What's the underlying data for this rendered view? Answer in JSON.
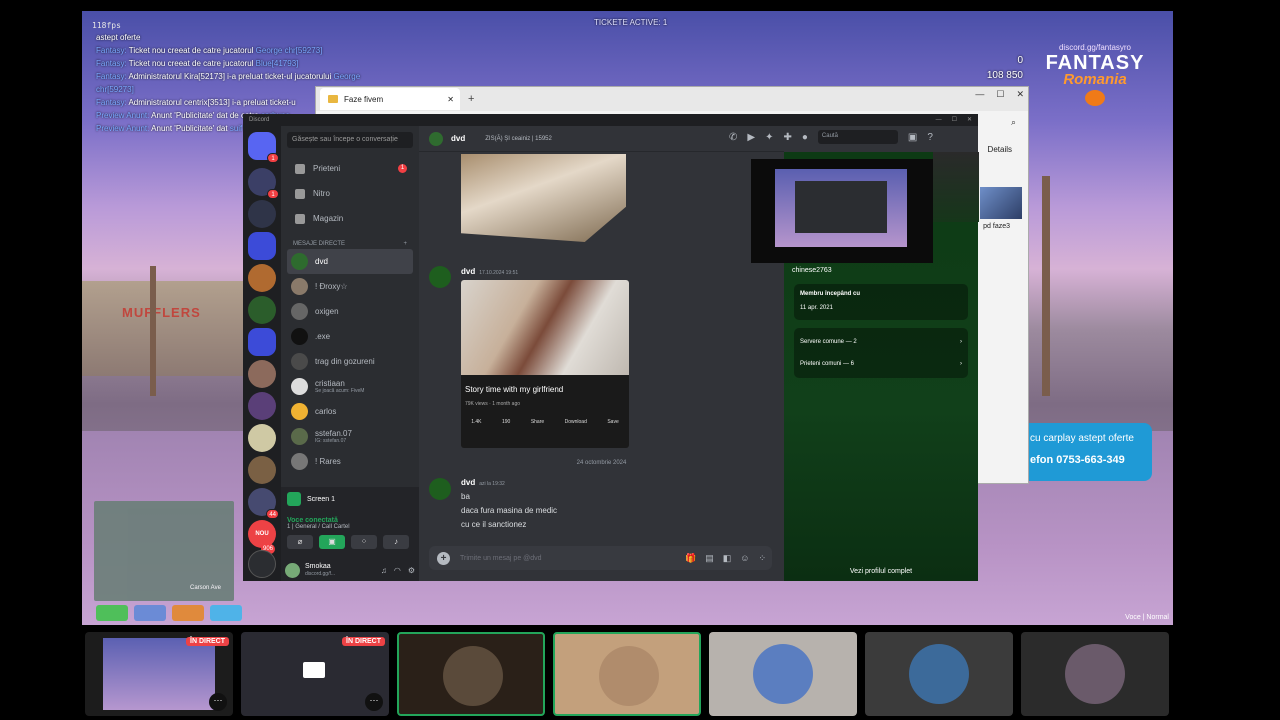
{
  "game": {
    "fps": "118fps",
    "ticket_title": "TICKETE ACTIVE: 1",
    "money_line1": "0",
    "money_line2": "108 850",
    "brand_url": "discord.gg/fantasyro",
    "brand_name": "FANTASY",
    "brand_sub": "Romania",
    "promo_line1": "cu carplay astept oferte",
    "promo_line2": "efon 0753-663-349",
    "voice_hud": "Voce | Normal",
    "street": "Carson Ave",
    "building_sign": "MUFFLERS",
    "chat": [
      {
        "prefix": "",
        "text": "astept oferte",
        "extra": ""
      },
      {
        "prefix": "Fantasy:",
        "text": "Ticket nou creeat de catre jucatorul",
        "extra": "George chr[59273]"
      },
      {
        "prefix": "Fantasy:",
        "text": "Ticket nou creeat de catre jucatorul",
        "extra": "Blue[41793]"
      },
      {
        "prefix": "Fantasy:",
        "text": "Administratorul Kira[52173] i-a preluat ticket-ul jucatorului",
        "extra": "George chr[59273]"
      },
      {
        "prefix": "Fantasy:",
        "text": "Administratorul centrix[3513] i-a preluat ticket-u",
        "extra": ""
      },
      {
        "prefix": "Preview Anunt:",
        "text": "Anunt 'Publicitate' dat de catre",
        "extra": "carbune"
      },
      {
        "prefix": "Preview Anunt:",
        "text": "Anunt 'Publicitate' dat",
        "extra": "suif si carbune ."
      }
    ]
  },
  "explorer": {
    "tab_title": "Faze fivem",
    "details": "Details",
    "file_label": "pd faze3"
  },
  "discord": {
    "app_title": "Discord",
    "search_placeholder": "Găsește sau începe o conversație",
    "nav": [
      {
        "label": "Prieteni",
        "badge": "1"
      },
      {
        "label": "Nitro",
        "badge": ""
      },
      {
        "label": "Magazin",
        "badge": ""
      }
    ],
    "dm_header": "MESAJE DIRECTE",
    "dms": [
      {
        "name": "dvd",
        "status": ""
      },
      {
        "name": "! Ðroxy☆",
        "status": ""
      },
      {
        "name": "oxigen",
        "status": ""
      },
      {
        "name": ".exe",
        "status": ""
      },
      {
        "name": "trag din gozureni",
        "status": ""
      },
      {
        "name": "cristiaan",
        "status": "Se joacă acum: FiveM"
      },
      {
        "name": "carlos",
        "status": ""
      },
      {
        "name": "sstefan.07",
        "status": "IG: sstefan.07"
      },
      {
        "name": "! Rares",
        "status": ""
      }
    ],
    "screen_label": "Screen 1",
    "voice_title": "Voce conectată",
    "voice_sub": "1 | General / Call Cartel",
    "user_name": "Smokaa",
    "user_tag": "discord.gg/f...",
    "server_badges": [
      "1",
      "1",
      "44",
      "906"
    ],
    "server_new": "NOU",
    "chat_header_name": "dvd",
    "chat_header_tag": "ZIS(Ă) ȘI  ceainiz | 15952",
    "search_label": "Caută",
    "msg1_author": "dvd",
    "msg1_date": "17.10.2024 19:51",
    "yt_title": "Story time with my girlfriend",
    "yt_meta": "79K views · 1 month ago",
    "yt_actions": [
      "1.4K",
      "190",
      "Share",
      "Download",
      "Save"
    ],
    "date_separator": "24 octombrie 2024",
    "msg2_author": "dvd",
    "msg2_date": "azi la 19:32",
    "msg2_lines": [
      "ba",
      "daca fura masina de medic",
      "cu ce il sanctionez"
    ],
    "composer_placeholder": "Trimite un mesaj pe @dvd",
    "profile_handle": "chinese2763",
    "member_since_label": "Membru începând cu",
    "member_since_value": "11 apr. 2021",
    "mutual_servers": "Servere comune — 2",
    "mutual_friends": "Prieteni comuni — 6",
    "full_profile": "Vezi profilul complet"
  },
  "bottom_tiles": [
    {
      "live": "ÎN DIRECT"
    },
    {
      "live": "ÎN DIRECT"
    }
  ]
}
